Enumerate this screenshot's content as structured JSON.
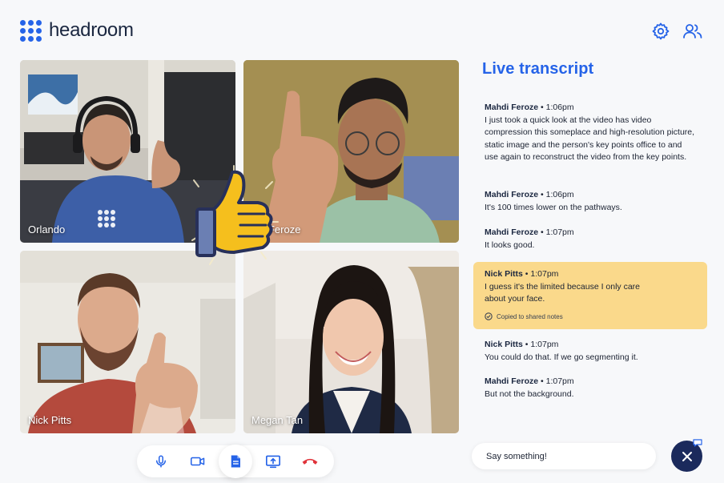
{
  "app": {
    "name": "headroom",
    "accent": "#2563e8",
    "icons": [
      "settings-icon",
      "participants-icon"
    ]
  },
  "participants": [
    {
      "name": "Orlando"
    },
    {
      "name": "Mahdi Feroze",
      "shown_label": "ndi Feroze"
    },
    {
      "name": "Nick Pitts"
    },
    {
      "name": "Megan Tan"
    }
  ],
  "reaction": {
    "icon": "thumbs-up-icon"
  },
  "controls": [
    {
      "icon": "microphone-icon"
    },
    {
      "icon": "camera-icon"
    },
    {
      "icon": "notes-icon",
      "active": true
    },
    {
      "icon": "share-screen-icon"
    },
    {
      "icon": "end-call-icon",
      "color": "#e0333a"
    }
  ],
  "transcript": {
    "title": "Live transcript",
    "entries": [
      {
        "speaker": "Mahdi Feroze",
        "time": "1:06pm",
        "text": "I just took a quick look at the video has video compression this someplace and high-resolution picture, static image and the person's key points office to and use again to reconstruct the video from the key points."
      },
      {
        "speaker": "Mahdi Feroze",
        "time": "1:06pm",
        "text": "It's 100 times lower on the pathways."
      },
      {
        "speaker": "Mahdi Feroze",
        "time": "1:07pm",
        "text": "It looks good."
      },
      {
        "speaker": "Nick Pitts",
        "time": "1:07pm",
        "text": "I guess it's the limited because I only care about your face.",
        "note": "Copied to shared notes",
        "highlight_color": "#fad98b"
      },
      {
        "speaker": "Nick Pitts",
        "time": "1:07pm",
        "text": "You could do that. If we go segmenting it."
      },
      {
        "speaker": "Mahdi Feroze",
        "time": "1:07pm",
        "text": "But not the background."
      }
    ],
    "separator": "•"
  },
  "chat": {
    "placeholder": "Say something!"
  }
}
